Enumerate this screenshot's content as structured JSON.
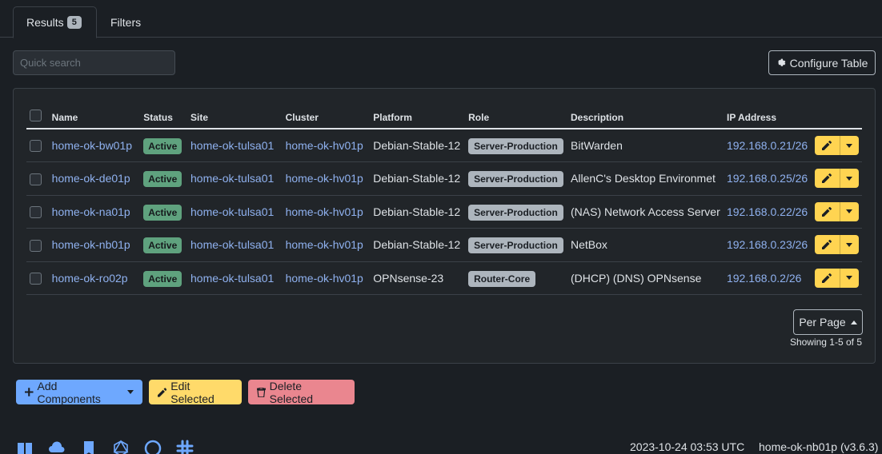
{
  "tabs": {
    "results_label": "Results",
    "results_count": "5",
    "filters_label": "Filters"
  },
  "search": {
    "placeholder": "Quick search"
  },
  "configure_label": "Configure Table",
  "columns": [
    "Name",
    "Status",
    "Site",
    "Cluster",
    "Platform",
    "Role",
    "Description",
    "IP Address"
  ],
  "rows": [
    {
      "name": "home-ok-bw01p",
      "status": "Active",
      "site": "home-ok-tulsa01",
      "cluster": "home-ok-hv01p",
      "platform": "Debian-Stable-12",
      "role": "Server-Production",
      "description": "BitWarden",
      "ip": "192.168.0.21/26"
    },
    {
      "name": "home-ok-de01p",
      "status": "Active",
      "site": "home-ok-tulsa01",
      "cluster": "home-ok-hv01p",
      "platform": "Debian-Stable-12",
      "role": "Server-Production",
      "description": "AllenC's Desktop Environmet",
      "ip": "192.168.0.25/26"
    },
    {
      "name": "home-ok-na01p",
      "status": "Active",
      "site": "home-ok-tulsa01",
      "cluster": "home-ok-hv01p",
      "platform": "Debian-Stable-12",
      "role": "Server-Production",
      "description": "(NAS) Network Access Server",
      "ip": "192.168.0.22/26"
    },
    {
      "name": "home-ok-nb01p",
      "status": "Active",
      "site": "home-ok-tulsa01",
      "cluster": "home-ok-hv01p",
      "platform": "Debian-Stable-12",
      "role": "Server-Production",
      "description": "NetBox",
      "ip": "192.168.0.23/26"
    },
    {
      "name": "home-ok-ro02p",
      "status": "Active",
      "site": "home-ok-tulsa01",
      "cluster": "home-ok-hv01p",
      "platform": "OPNsense-23",
      "role": "Router-Core",
      "description": "(DHCP) (DNS) OPNsense",
      "ip": "192.168.0.2/26"
    }
  ],
  "pagination": {
    "per_page_label": "Per Page",
    "showing": "Showing 1-5 of 5"
  },
  "buttons": {
    "add": "Add Components",
    "edit": "Edit Selected",
    "delete": "Delete Selected"
  },
  "footer": {
    "icons": [
      "docs-icon",
      "api-cloud-icon",
      "bookmark-icon",
      "graphql-icon",
      "github-icon",
      "slack-icon"
    ],
    "timestamp": "2023-10-24 03:53 UTC",
    "hostname_version": "home-ok-nb01p (v3.6.3)"
  },
  "colors": {
    "accent": "#6ea8fe",
    "link": "#8fb1ef",
    "status_active": "#5fa27e",
    "warning": "#ffda6a",
    "danger": "#ea868f"
  }
}
